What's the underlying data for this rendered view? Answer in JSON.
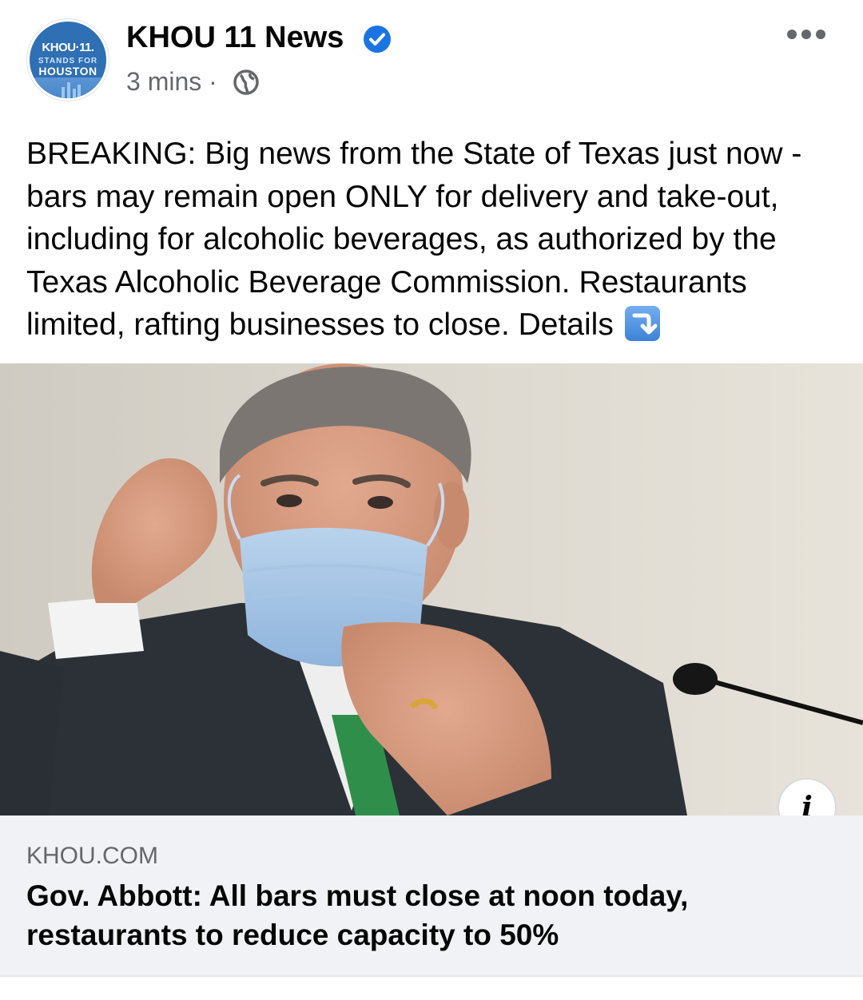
{
  "post": {
    "page_name": "KHOU 11 News",
    "time": "3 mins",
    "separator": "·",
    "avatar_logo": {
      "line1": "KHOU·11.",
      "line2": "STANDS FOR",
      "line3": "HOUSTON"
    },
    "text": "BREAKING: Big news from the State of Texas just now - bars may remain open ONLY for delivery and take-out, including for alcoholic beverages, as authorized by the Texas Alcoholic Beverage Commission. Restaurants limited, rafting businesses to close. Details",
    "icons": {
      "verified": "verified-badge-icon",
      "privacy": "globe-icon",
      "more": "more-options-icon",
      "details_emoji": "arrow-down-emoji-icon",
      "info": "info-icon"
    },
    "info_glyph": "i"
  },
  "link": {
    "domain": "KHOU.COM",
    "title": "Gov. Abbott: All bars must close at noon today, restaurants to reduce capacity to 50%"
  },
  "colors": {
    "verified_blue": "#1b74e4",
    "secondary_text": "#65676b",
    "card_bg": "#f0f2f5",
    "logo_blue": "#2f6fb3"
  }
}
